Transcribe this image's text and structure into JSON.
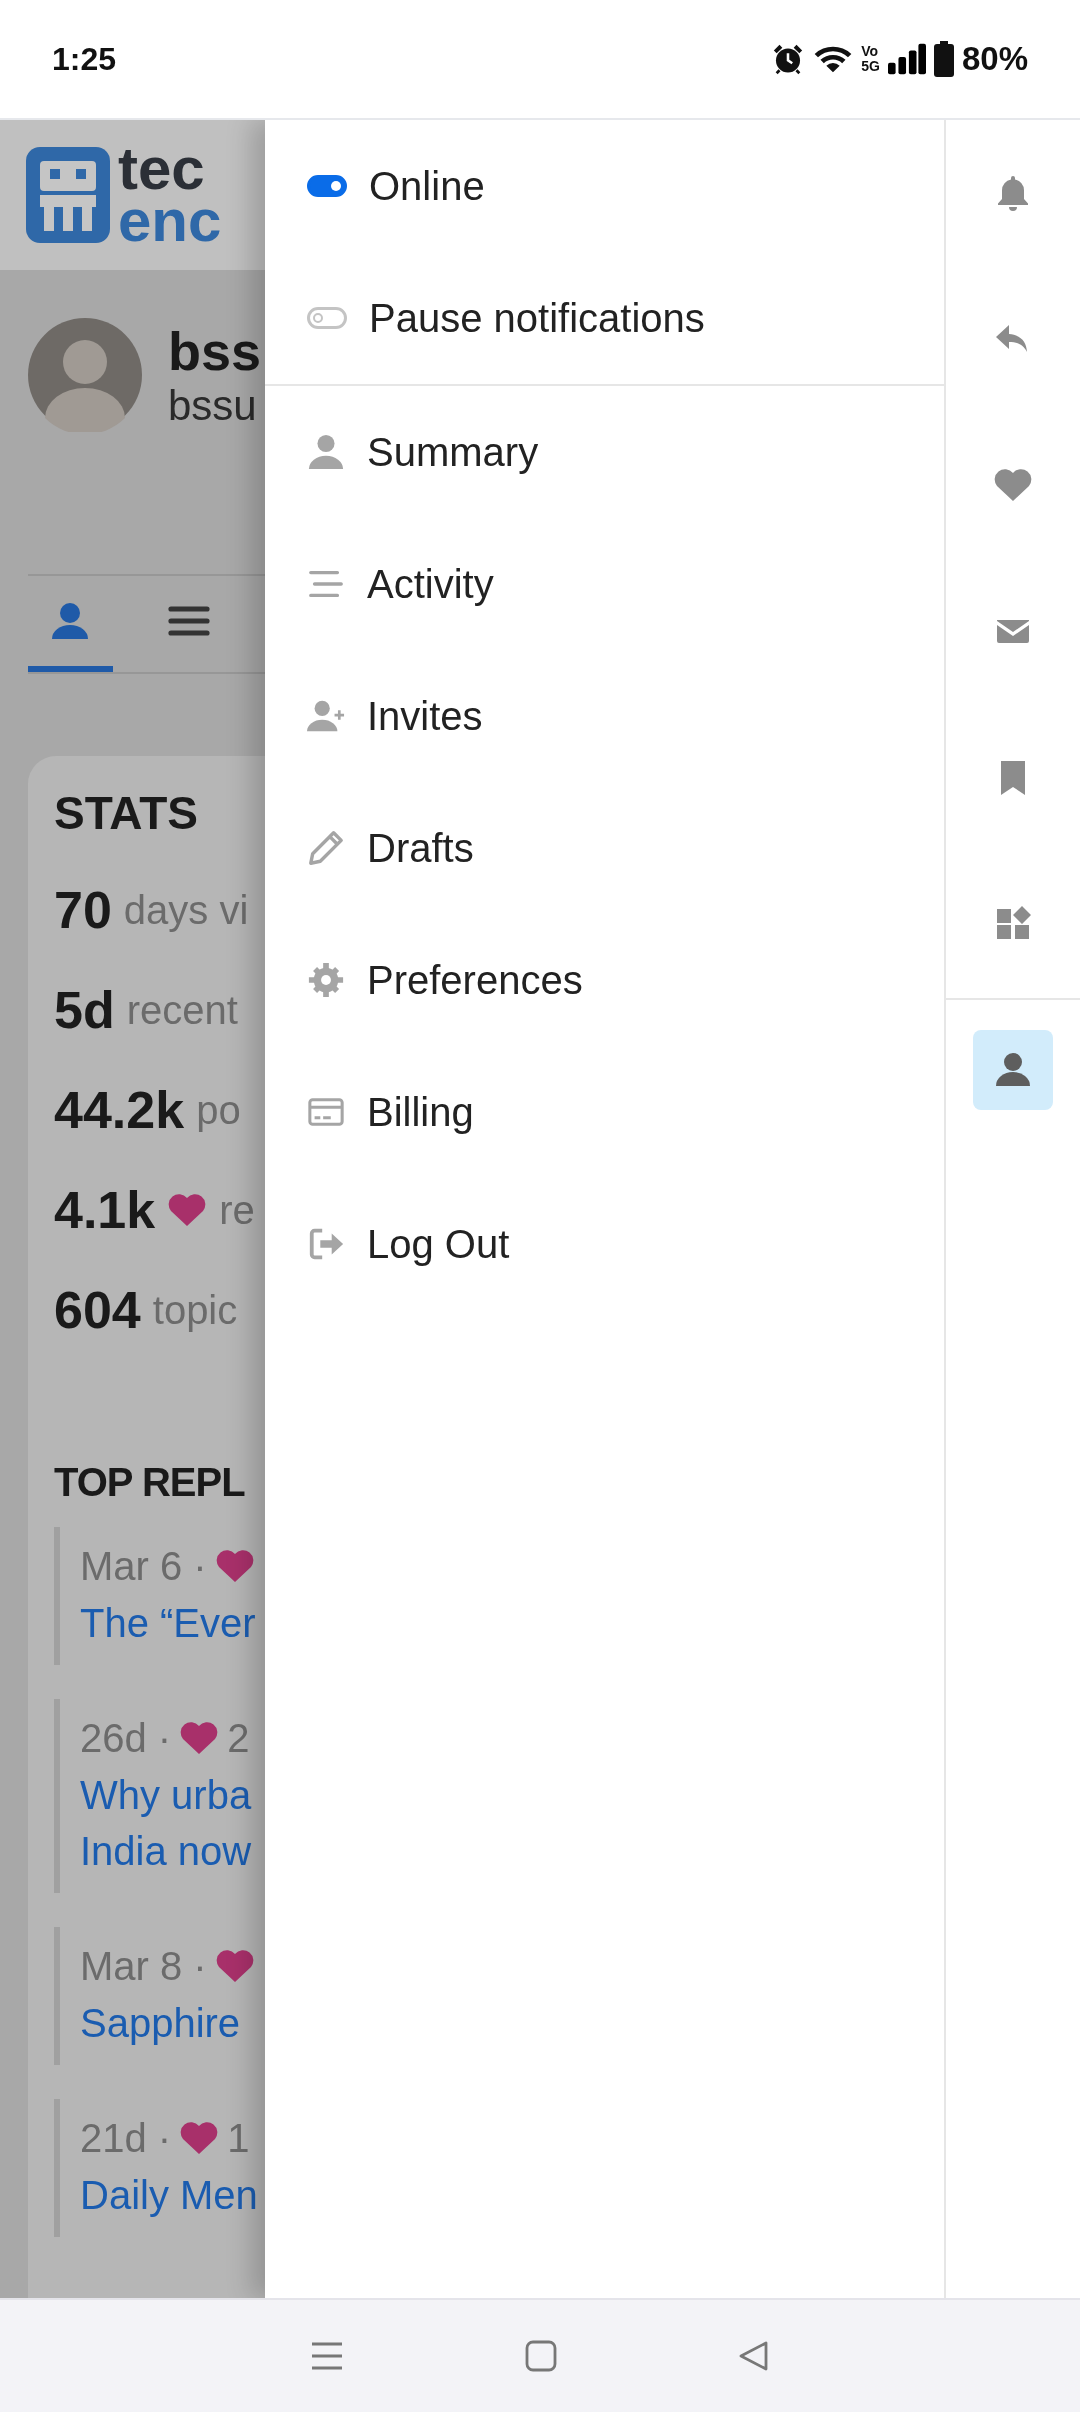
{
  "status_bar": {
    "time": "1:25",
    "network_top": "Vo",
    "network_bottom": "5G",
    "battery": "80%"
  },
  "background_page": {
    "logo": [
      "tec",
      "enc"
    ],
    "user": {
      "name": "bss",
      "username": "bssu"
    },
    "tabs": [
      {
        "kind": "summary",
        "selected": true
      },
      {
        "kind": "activity",
        "selected": false
      }
    ],
    "stats": {
      "title": "STATS",
      "items": [
        {
          "value": "70",
          "label": "days vi",
          "heart": false
        },
        {
          "value": "5d",
          "label": "recent",
          "heart": false
        },
        {
          "value": "44.2k",
          "label": "po",
          "heart": false
        },
        {
          "value": "4.1k",
          "label": "re",
          "heart": true
        },
        {
          "value": "604",
          "label": "topic",
          "heart": false
        }
      ]
    },
    "top_replies": {
      "title": "TOP REPL",
      "items": [
        {
          "meta": "Mar 6 ·",
          "title_lines": [
            "The “Ever"
          ]
        },
        {
          "meta": "26d ·",
          "likes": "2",
          "title_lines": [
            "Why urba",
            "India now"
          ]
        },
        {
          "meta": "Mar 8 ·",
          "title_lines": [
            "Sapphire"
          ]
        },
        {
          "meta": "21d ·",
          "likes": "1",
          "title_lines": [
            "Daily Men"
          ]
        }
      ]
    }
  },
  "menu": {
    "toggles": [
      {
        "label": "Online",
        "on": true
      },
      {
        "label": "Pause notifications",
        "on": false
      }
    ],
    "items": [
      {
        "kind": "summary",
        "label": "Summary"
      },
      {
        "kind": "activity",
        "label": "Activity"
      },
      {
        "kind": "invites",
        "label": "Invites"
      },
      {
        "kind": "drafts",
        "label": "Drafts"
      },
      {
        "kind": "preferences",
        "label": "Preferences"
      },
      {
        "kind": "billing",
        "label": "Billing"
      },
      {
        "kind": "logout",
        "label": "Log Out"
      }
    ]
  },
  "quick_access": [
    {
      "kind": "notifications",
      "selected": false
    },
    {
      "kind": "replies",
      "selected": false
    },
    {
      "kind": "likes",
      "selected": false
    },
    {
      "kind": "messages",
      "selected": false
    },
    {
      "kind": "bookmarks",
      "selected": false
    },
    {
      "kind": "other",
      "selected": false
    },
    {
      "kind": "profile",
      "selected": true
    }
  ]
}
